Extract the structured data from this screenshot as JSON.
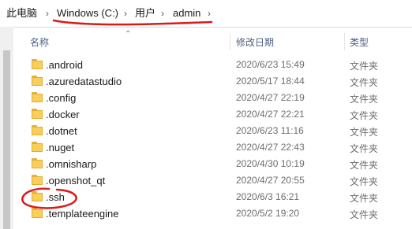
{
  "breadcrumb": {
    "items": [
      "此电脑",
      "Windows (C:)",
      "用户",
      "admin"
    ],
    "separator": "›"
  },
  "columns": {
    "name": "名称",
    "modified": "修改日期",
    "type": "类型"
  },
  "folders": [
    {
      "name": ".android",
      "modified": "2020/6/23 15:49",
      "type": "文件夹"
    },
    {
      "name": ".azuredatastudio",
      "modified": "2020/5/17 18:44",
      "type": "文件夹"
    },
    {
      "name": ".config",
      "modified": "2020/4/27 22:19",
      "type": "文件夹"
    },
    {
      "name": ".docker",
      "modified": "2020/4/27 22:21",
      "type": "文件夹"
    },
    {
      "name": ".dotnet",
      "modified": "2020/6/23 11:16",
      "type": "文件夹"
    },
    {
      "name": ".nuget",
      "modified": "2020/4/27 22:43",
      "type": "文件夹"
    },
    {
      "name": ".omnisharp",
      "modified": "2020/4/30 10:19",
      "type": "文件夹"
    },
    {
      "name": ".openshot_qt",
      "modified": "2020/4/27 20:55",
      "type": "文件夹"
    },
    {
      "name": ".ssh",
      "modified": "2020/6/3 16:21",
      "type": "文件夹"
    },
    {
      "name": ".templateengine",
      "modified": "2020/5/2 19:20",
      "type": "文件夹"
    }
  ],
  "colors": {
    "annotation": "#d81b1b",
    "folder": "#f7cf5a"
  }
}
